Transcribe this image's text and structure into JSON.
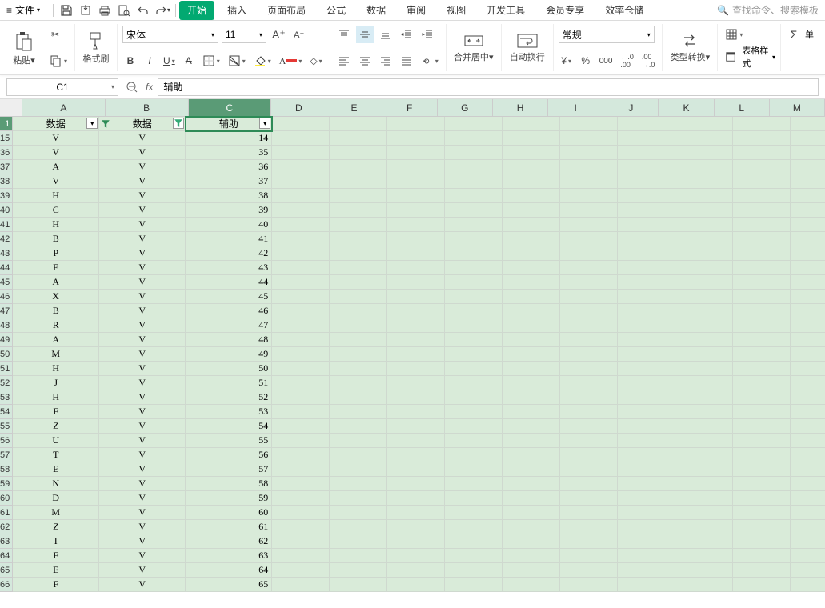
{
  "titlebar": {
    "file": "文件"
  },
  "tabs": {
    "start": "开始",
    "insert": "插入",
    "layout": "页面布局",
    "formula": "公式",
    "data": "数据",
    "review": "审阅",
    "view": "视图",
    "dev": "开发工具",
    "member": "会员专享",
    "eff": "效率仓储"
  },
  "search": {
    "placeholder": "查找命令、搜索模板"
  },
  "ribbon": {
    "paste": "粘贴",
    "fmtpaint": "格式刷",
    "font_name": "宋体",
    "font_size": "11",
    "merge": "合并居中",
    "wrap": "自动换行",
    "numfmt": "常规",
    "typeconv": "类型转换",
    "tablestyle": "表格样式",
    "single": "单"
  },
  "namebox": {
    "ref": "C1"
  },
  "formula": {
    "value": "辅助"
  },
  "colHeaders": [
    "A",
    "B",
    "C",
    "D",
    "E",
    "F",
    "G",
    "H",
    "I",
    "J",
    "K",
    "L",
    "M"
  ],
  "rowHeaders": [
    "1",
    "15",
    "36",
    "37",
    "38",
    "39",
    "40",
    "41",
    "42",
    "43",
    "44",
    "45",
    "46",
    "47",
    "48",
    "49",
    "50",
    "51",
    "52",
    "53",
    "54",
    "55",
    "56",
    "57",
    "58",
    "59",
    "60",
    "61",
    "62",
    "63",
    "64",
    "65",
    "66"
  ],
  "headerRow": {
    "a": "数据",
    "b": "数据",
    "c": "辅助"
  },
  "rows": [
    {
      "a": "V",
      "b": "V",
      "c": "14"
    },
    {
      "a": "V",
      "b": "V",
      "c": "35"
    },
    {
      "a": "A",
      "b": "V",
      "c": "36"
    },
    {
      "a": "V",
      "b": "V",
      "c": "37"
    },
    {
      "a": "H",
      "b": "V",
      "c": "38"
    },
    {
      "a": "C",
      "b": "V",
      "c": "39"
    },
    {
      "a": "H",
      "b": "V",
      "c": "40"
    },
    {
      "a": "B",
      "b": "V",
      "c": "41"
    },
    {
      "a": "P",
      "b": "V",
      "c": "42"
    },
    {
      "a": "E",
      "b": "V",
      "c": "43"
    },
    {
      "a": "A",
      "b": "V",
      "c": "44"
    },
    {
      "a": "X",
      "b": "V",
      "c": "45"
    },
    {
      "a": "B",
      "b": "V",
      "c": "46"
    },
    {
      "a": "R",
      "b": "V",
      "c": "47"
    },
    {
      "a": "A",
      "b": "V",
      "c": "48"
    },
    {
      "a": "M",
      "b": "V",
      "c": "49"
    },
    {
      "a": "H",
      "b": "V",
      "c": "50"
    },
    {
      "a": "J",
      "b": "V",
      "c": "51"
    },
    {
      "a": "H",
      "b": "V",
      "c": "52"
    },
    {
      "a": "F",
      "b": "V",
      "c": "53"
    },
    {
      "a": "Z",
      "b": "V",
      "c": "54"
    },
    {
      "a": "U",
      "b": "V",
      "c": "55"
    },
    {
      "a": "T",
      "b": "V",
      "c": "56"
    },
    {
      "a": "E",
      "b": "V",
      "c": "57"
    },
    {
      "a": "N",
      "b": "V",
      "c": "58"
    },
    {
      "a": "D",
      "b": "V",
      "c": "59"
    },
    {
      "a": "M",
      "b": "V",
      "c": "60"
    },
    {
      "a": "Z",
      "b": "V",
      "c": "61"
    },
    {
      "a": "I",
      "b": "V",
      "c": "62"
    },
    {
      "a": "F",
      "b": "V",
      "c": "63"
    },
    {
      "a": "E",
      "b": "V",
      "c": "64"
    },
    {
      "a": "F",
      "b": "V",
      "c": "65"
    }
  ]
}
